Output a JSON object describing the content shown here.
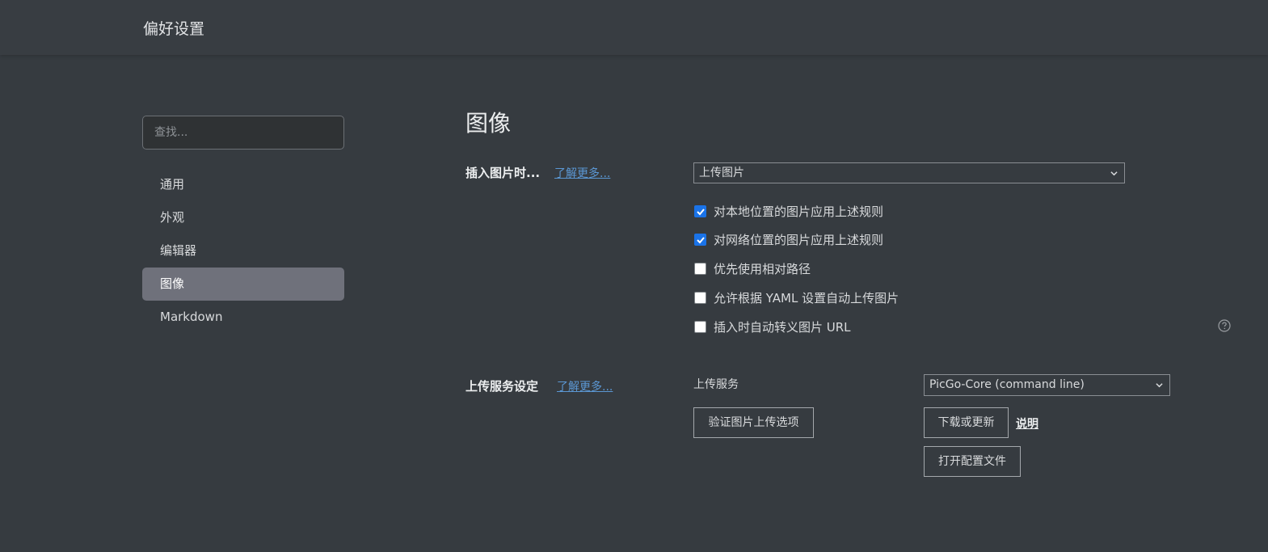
{
  "window": {
    "title": "偏好设置"
  },
  "sidebar": {
    "search_placeholder": "查找...",
    "items": [
      {
        "label": "通用",
        "active": false
      },
      {
        "label": "外观",
        "active": false
      },
      {
        "label": "编辑器",
        "active": false
      },
      {
        "label": "图像",
        "active": true
      },
      {
        "label": "Markdown",
        "active": false
      }
    ]
  },
  "main": {
    "title": "图像",
    "insert_section": {
      "label": "插入图片时...",
      "learn_more": "了解更多...",
      "action_select": "上传图片",
      "options": [
        {
          "label": "对本地位置的图片应用上述规则",
          "checked": true
        },
        {
          "label": "对网络位置的图片应用上述规则",
          "checked": true
        },
        {
          "label": "优先使用相对路径",
          "checked": false
        },
        {
          "label": "允许根据 YAML 设置自动上传图片",
          "checked": false
        },
        {
          "label": "插入时自动转义图片 URL",
          "checked": false
        }
      ],
      "help_icon": "question-circle-icon"
    },
    "upload_section": {
      "label": "上传服务设定",
      "learn_more": "了解更多...",
      "service_label": "上传服务",
      "service_select": "PicGo-Core (command line)",
      "validate_button": "验证图片上传选项",
      "download_button": "下载或更新",
      "explain_link": "说明",
      "open_config_button": "打开配置文件"
    }
  },
  "colors": {
    "background": "#363b40",
    "active_item": "#6f717b",
    "link": "#5b97d3",
    "checkbox_checked": "#1a73e8"
  }
}
